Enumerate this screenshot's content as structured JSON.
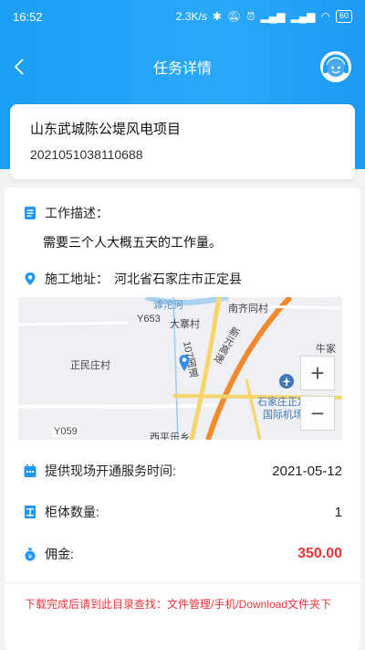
{
  "statusbar": {
    "time": "16:52",
    "net_speed": "2.3K/s",
    "battery": "60"
  },
  "navbar": {
    "title": "任务详情"
  },
  "project": {
    "name": "山东武城陈公堤风电项目",
    "code": "2021051038110688"
  },
  "work": {
    "desc_label": "工作描述：",
    "desc_text": "需要三个人大概五天的工作量。",
    "address_label": "施工地址：",
    "address_value": "河北省石家庄市正定县"
  },
  "map": {
    "labels": {
      "river": "滹沱河",
      "nanqi": "南齐同村",
      "y653": "Y653",
      "dazhai": "大寨村",
      "niujia": "牛家",
      "road107": "107国道",
      "xinyuan": "新元高速",
      "zhengmin": "正民庄村",
      "airport1": "石家庄正定",
      "airport2": "国际机场",
      "y059": "Y059",
      "xiping": "西平乐乡"
    },
    "zoom_in": "+",
    "zoom_out": "−"
  },
  "info": {
    "service_time_label": "提供现场开通服务时间:",
    "service_time_value": "2021-05-12",
    "cabinet_label": "柜体数量:",
    "cabinet_value": "1",
    "commission_label": "佣金:",
    "commission_value": "350.00"
  },
  "notice": "下载完成后请到此目录查找：文件管理/手机/Download文件夹下",
  "colors": {
    "primary": "#1c9ff7",
    "price": "#e8363b",
    "icon_blue": "#2196f3"
  }
}
